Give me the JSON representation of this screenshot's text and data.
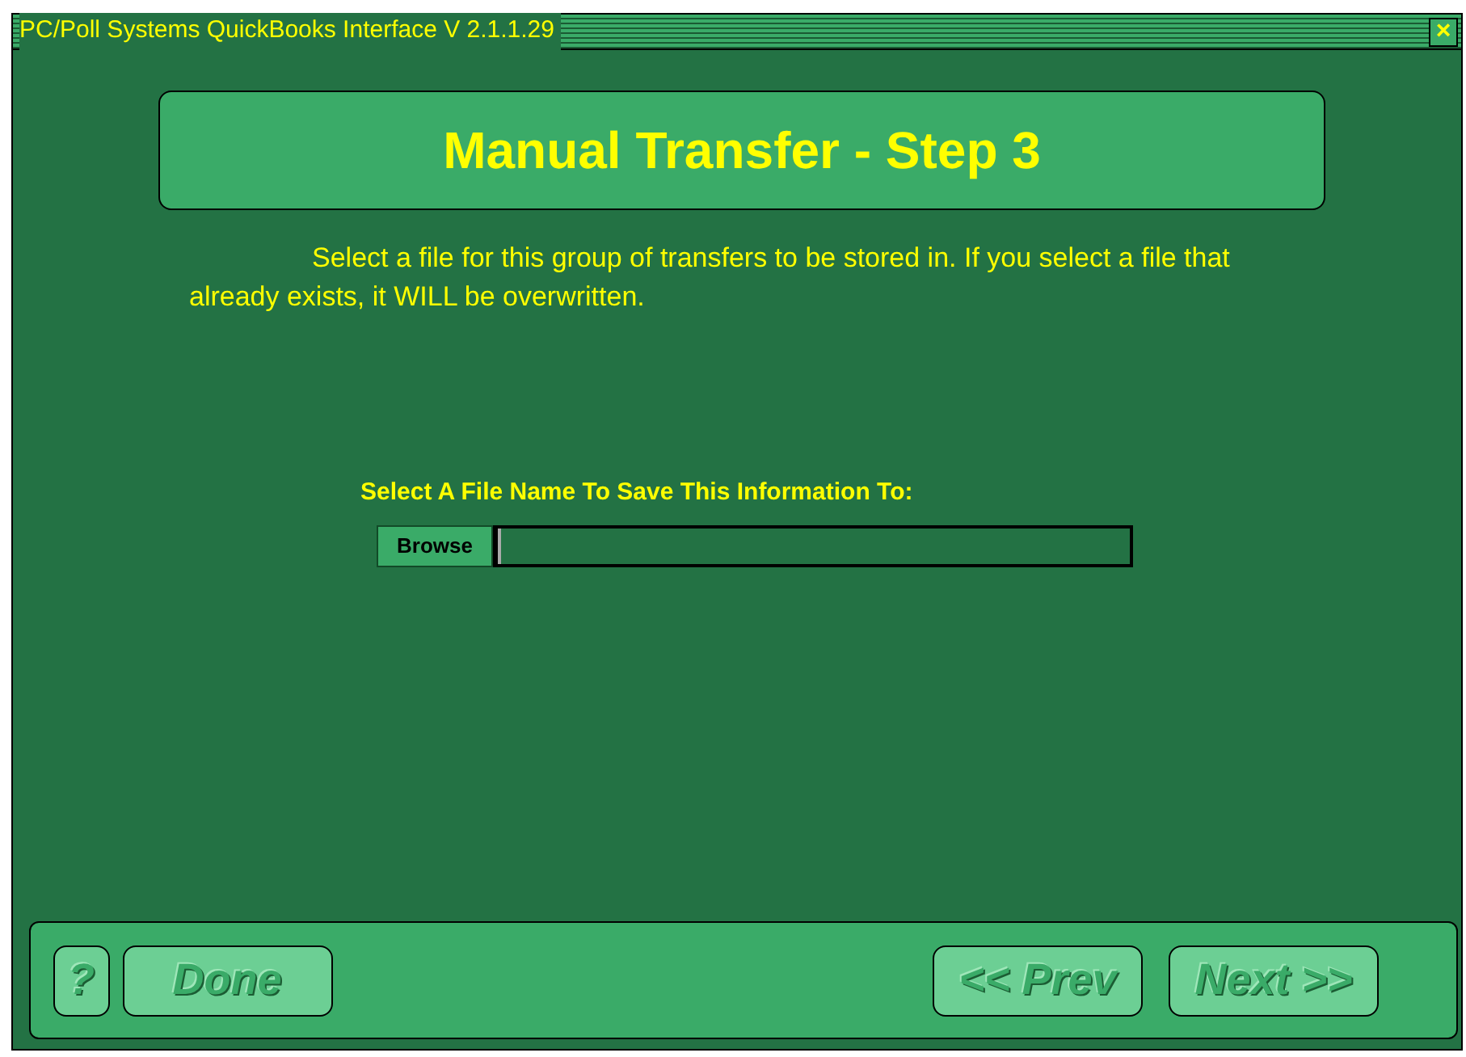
{
  "window": {
    "title": "PC/Poll Systems QuickBooks Interface  V 2.1.1.29",
    "close": "×"
  },
  "header": {
    "title": "Manual Transfer - Step 3"
  },
  "description": "Select a file for this group of transfers to be stored in.  If you select a file that already exists, it WILL be overwritten.",
  "file_field": {
    "label": "Select A File Name To Save This Information To:",
    "button": "Browse",
    "focused": true
  },
  "buttons": [
    {
      "label": "?",
      "disabled": true
    },
    {
      "label": "Done",
      "disabled": true
    },
    {
      "label": "<< Prev",
      "disabled": true
    },
    {
      "label": "Next >>",
      "disabled": true
    }
  ]
}
